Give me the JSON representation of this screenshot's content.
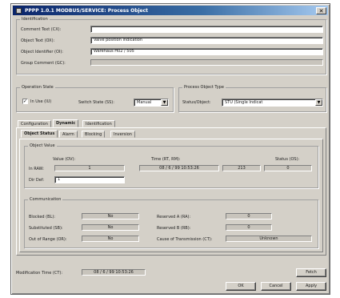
{
  "window": {
    "title": "PPPP 1.0.1 MODBUS/SERVICE: Process Object",
    "close_glyph": "✕"
  },
  "identification": {
    "legend": "Identification",
    "fields": [
      {
        "label": "Comment Text (CX):",
        "value": ""
      },
      {
        "label": "Object Text (OX):",
        "value": "Valve position indication"
      },
      {
        "label": "Object Identifier (OI):",
        "value": "Warehaus      H02 / 505"
      },
      {
        "label": "Group Comment (GC):",
        "value": ""
      }
    ]
  },
  "operation_state": {
    "legend": "Operation State",
    "in_use_label": "In Use (IU)",
    "in_use_checked": "✓",
    "switch_state_label": "Switch State (SS):",
    "switch_state_value": "Manual"
  },
  "process_object_type": {
    "legend": "Process Object Type",
    "label": "Status/Object:",
    "value": "STU (Single Indicat"
  },
  "tabs": [
    "Configuration",
    "Dynamic",
    "Identification"
  ],
  "subtabs": [
    "Object Status",
    "Alarm",
    "Blocking",
    "Inversion"
  ],
  "object_value": {
    "legend": "Object Value",
    "col_value": "Value (OV):",
    "col_time": "Time (RT, RM):",
    "col_status": "Status (OS):",
    "row_label": "In RAW:",
    "value": "1",
    "time": "08 / 6 / 99  10:53:26",
    "time_extra": "213",
    "status": "0",
    "dx_label": "Dir Def:",
    "dx_value": "1"
  },
  "communication": {
    "legend": "Communication",
    "left": [
      {
        "label": "Blocked (BL):",
        "value": "No"
      },
      {
        "label": "Substituted (SB):",
        "value": "No"
      },
      {
        "label": "Out of Range (OR):",
        "value": "No"
      }
    ],
    "right": [
      {
        "label": "Reserved A (RA):",
        "value": "0"
      },
      {
        "label": "Reserved B (RB):",
        "value": "0"
      },
      {
        "label": "Cause of Transmission (CT):",
        "value": "Unknown"
      }
    ]
  },
  "footer": {
    "mod_time_label": "Modification Time (CT):",
    "mod_time_value": "08 / 6 / 99  10:53:26",
    "fetch_label": "Fetch",
    "ok_label": "OK",
    "cancel_label": "Cancel",
    "apply_label": "Apply"
  }
}
